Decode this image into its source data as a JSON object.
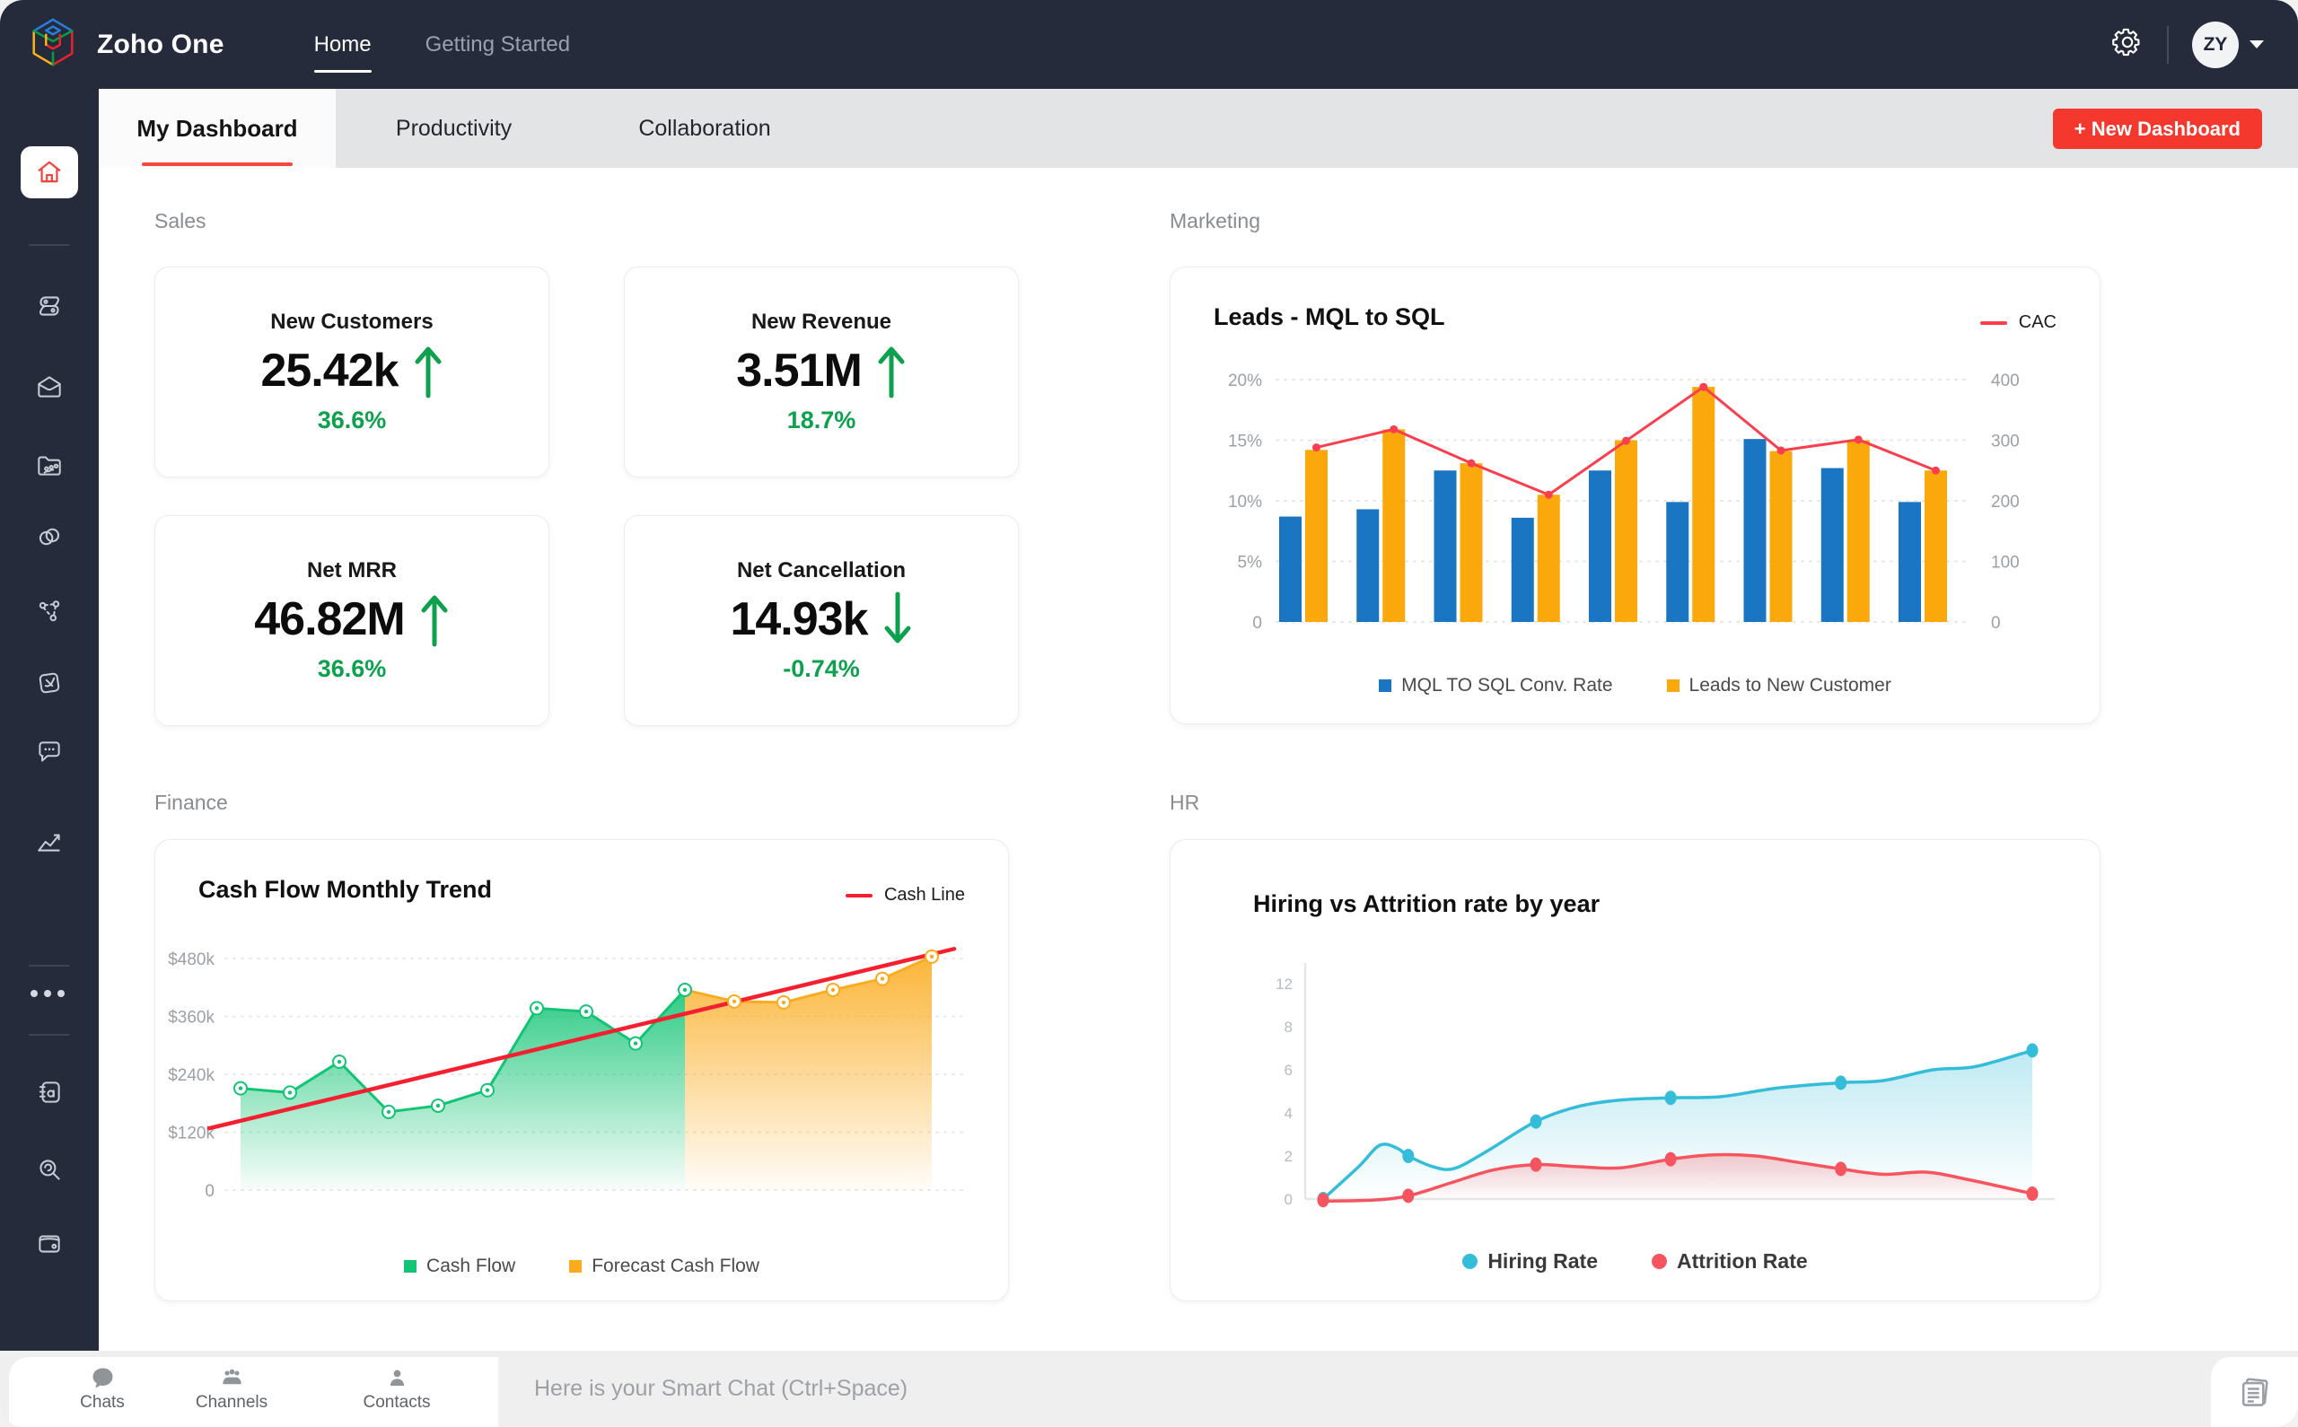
{
  "topbar": {
    "app_title": "Zoho One",
    "nav": [
      {
        "label": "Home",
        "active": true
      },
      {
        "label": "Getting Started",
        "active": false
      }
    ],
    "avatar_initials": "ZY"
  },
  "sidebar": {
    "items": [
      "home",
      "crm",
      "mail",
      "workdrive",
      "zoho-one",
      "connect",
      "sign",
      "cliq",
      "analytics",
      "more",
      "notebook",
      "zia-search",
      "expense"
    ]
  },
  "tabs": {
    "items": [
      {
        "label": "My Dashboard",
        "active": true
      },
      {
        "label": "Productivity",
        "active": false
      },
      {
        "label": "Collaboration",
        "active": false
      }
    ],
    "new_dashboard": "+ New Dashboard"
  },
  "sections": {
    "sales": {
      "label": "Sales",
      "cards": [
        {
          "title": "New Customers",
          "value": "25.42k",
          "direction": "up",
          "change": "36.6%"
        },
        {
          "title": "New Revenue",
          "value": "3.51M",
          "direction": "up",
          "change": "18.7%"
        },
        {
          "title": "Net MRR",
          "value": "46.82M",
          "direction": "up",
          "change": "36.6%"
        },
        {
          "title": "Net Cancellation",
          "value": "14.93k",
          "direction": "down",
          "change": "-0.74%"
        }
      ]
    },
    "marketing": {
      "label": "Marketing"
    },
    "finance": {
      "label": "Finance"
    },
    "hr": {
      "label": "HR"
    }
  },
  "chart_data": [
    {
      "id": "leads",
      "type": "bar",
      "title": "Leads - MQL to SQL",
      "left_axis": {
        "tick_labels": [
          "20%",
          "15%",
          "10%",
          "5%",
          "0"
        ],
        "max": 20,
        "min": 0
      },
      "right_axis": {
        "tick_labels": [
          "400",
          "300",
          "200",
          "100",
          "0"
        ],
        "max": 400,
        "min": 0
      },
      "series": [
        {
          "name": "MQL TO SQL Conv. Rate",
          "color": "#1a75c2",
          "axis": "left",
          "values": [
            8.7,
            9.3,
            12.5,
            8.6,
            12.5,
            9.9,
            15.1,
            12.7,
            9.9
          ]
        },
        {
          "name": "Leads to New Customer",
          "color": "#fba80d",
          "axis": "left",
          "values": [
            14.2,
            15.9,
            13.1,
            10.5,
            15.0,
            19.4,
            14.1,
            15.0,
            12.5
          ]
        }
      ],
      "line": {
        "name": "CAC",
        "color": "#fb3e4e",
        "axis": "right",
        "values": [
          288,
          318,
          262,
          210,
          299,
          388,
          283,
          301,
          250
        ]
      },
      "grid": "dotted-horizontal",
      "legend_position": "bottom"
    },
    {
      "id": "cashflow",
      "type": "area",
      "title": "Cash Flow Monthly Trend",
      "y_axis": {
        "tick_labels": [
          "$480k",
          "$360k",
          "$240k",
          "$120k",
          "0"
        ],
        "max": 480,
        "min": 0,
        "unit": "$k"
      },
      "series": [
        {
          "name": "Cash Flow",
          "color": "#12c474",
          "values_k": [
            211,
            202,
            266,
            162,
            175,
            207,
            377,
            370,
            304,
            415
          ]
        },
        {
          "name": "Forecast Cash Flow",
          "color": "#fbab1e",
          "start_index": 9,
          "values_k": [
            415,
            391,
            389,
            415,
            438,
            484
          ]
        }
      ],
      "trend_line": {
        "name": "Cash Line",
        "color": "#f5202f",
        "start_k": 128,
        "end_k": 500
      },
      "grid": "dotted-horizontal",
      "legend_position": "bottom"
    },
    {
      "id": "hr",
      "type": "line",
      "title": "Hiring vs Attrition rate by year",
      "y_axis": {
        "tick_labels": [
          "12",
          "8",
          "6",
          "4",
          "2",
          "0"
        ]
      },
      "series": [
        {
          "name": "Hiring Rate",
          "color": "#34bdd8",
          "markers": [
            [
              0,
              0
            ],
            [
              0.12,
              2.0
            ],
            [
              0.3,
              3.6
            ],
            [
              0.49,
              4.7
            ],
            [
              0.73,
              5.4
            ],
            [
              1.0,
              6.9
            ]
          ],
          "curve": [
            [
              0,
              0
            ],
            [
              0.05,
              1.5
            ],
            [
              0.08,
              2.5
            ],
            [
              0.105,
              2.35
            ],
            [
              0.12,
              2.0
            ],
            [
              0.155,
              1.5
            ],
            [
              0.185,
              1.42
            ],
            [
              0.23,
              2.2
            ],
            [
              0.3,
              3.6
            ],
            [
              0.36,
              4.3
            ],
            [
              0.42,
              4.6
            ],
            [
              0.49,
              4.7
            ],
            [
              0.56,
              4.75
            ],
            [
              0.64,
              5.15
            ],
            [
              0.73,
              5.4
            ],
            [
              0.79,
              5.5
            ],
            [
              0.86,
              6.0
            ],
            [
              0.92,
              6.15
            ],
            [
              1.0,
              6.9
            ]
          ]
        },
        {
          "name": "Attrition Rate",
          "color": "#f6545e",
          "markers": [
            [
              0,
              -0.05
            ],
            [
              0.12,
              0.15
            ],
            [
              0.3,
              1.6
            ],
            [
              0.49,
              1.85
            ],
            [
              0.73,
              1.4
            ],
            [
              1.0,
              0.25
            ]
          ],
          "curve": [
            [
              0,
              -0.1
            ],
            [
              0.07,
              -0.05
            ],
            [
              0.12,
              0.15
            ],
            [
              0.18,
              0.75
            ],
            [
              0.24,
              1.35
            ],
            [
              0.3,
              1.6
            ],
            [
              0.36,
              1.5
            ],
            [
              0.42,
              1.45
            ],
            [
              0.49,
              1.85
            ],
            [
              0.55,
              2.05
            ],
            [
              0.61,
              2.0
            ],
            [
              0.67,
              1.7
            ],
            [
              0.73,
              1.4
            ],
            [
              0.79,
              1.15
            ],
            [
              0.85,
              1.25
            ],
            [
              0.91,
              0.9
            ],
            [
              1.0,
              0.25
            ]
          ]
        }
      ],
      "legend_position": "bottom"
    }
  ],
  "chatbar": {
    "items": [
      {
        "label": "Chats"
      },
      {
        "label": "Channels"
      },
      {
        "label": "Contacts"
      }
    ],
    "smart_chat_placeholder": "Here is your Smart Chat (Ctrl+Space)"
  },
  "colors": {
    "topbar_bg": "#252b3b",
    "accent_red": "#f5382e",
    "kpi_green": "#0da14e",
    "tabstrip_bg": "#e3e4e6"
  }
}
